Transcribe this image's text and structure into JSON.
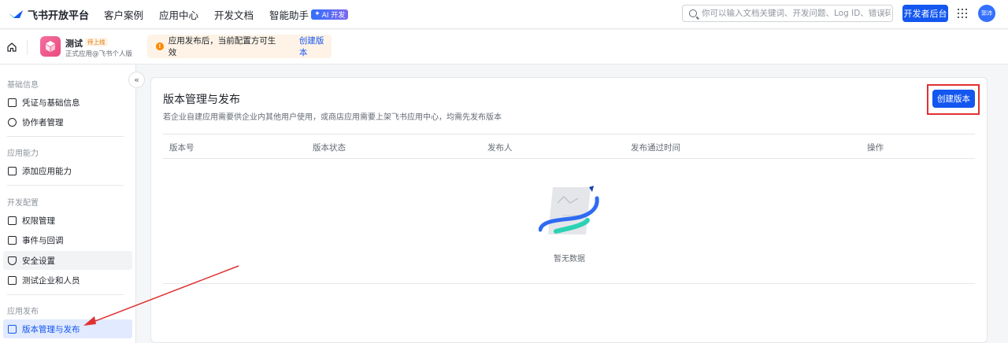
{
  "topnav": {
    "brand": "飞书开放平台",
    "links": [
      "客户案例",
      "应用中心",
      "开发文档",
      "智能助手"
    ],
    "ai_badge": "AI 开发",
    "search_placeholder": "你可以输入文档关键词、开发问题、Log ID、错误码",
    "console_button": "开发者后台",
    "avatar_text": "郭沛"
  },
  "app_header": {
    "app_name": "测试",
    "app_status": "待上线",
    "app_sub": "正式应用@飞书个人版",
    "notice_text": "应用发布后，当前配置方可生效",
    "notice_link": "创建版本"
  },
  "sidebar": {
    "groups": [
      {
        "title": "基础信息",
        "items": [
          "凭证与基础信息",
          "协作者管理"
        ]
      },
      {
        "title": "应用能力",
        "items": [
          "添加应用能力"
        ]
      },
      {
        "title": "开发配置",
        "items": [
          "权限管理",
          "事件与回调",
          "安全设置",
          "测试企业和人员"
        ]
      },
      {
        "title": "应用发布",
        "items": [
          "版本管理与发布"
        ]
      }
    ]
  },
  "main": {
    "title": "版本管理与发布",
    "description": "若企业自建应用需要供企业内其他用户使用，或商店应用需要上架飞书应用中心，均需先发布版本",
    "create_button": "创建版本",
    "columns": [
      "版本号",
      "版本状态",
      "发布人",
      "发布通过时间",
      "操作"
    ],
    "empty_text": "暂无数据"
  },
  "colors": {
    "accent": "#1456f0",
    "highlight_box": "#e03131",
    "warning": "#ff8800"
  }
}
